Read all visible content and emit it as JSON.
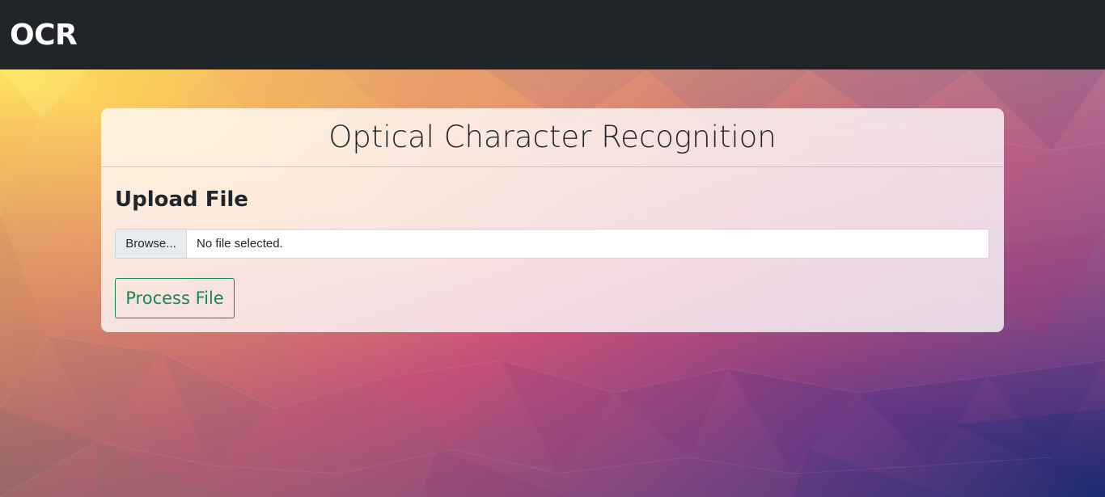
{
  "navbar": {
    "brand": "OCR"
  },
  "card": {
    "title": "Optical Character Recognition",
    "section_title": "Upload File",
    "file_input": {
      "browse_label": "Browse...",
      "status": "No file selected."
    },
    "process_button_label": "Process File"
  },
  "colors": {
    "navbar": "#212529",
    "accent_success": "#198754"
  }
}
